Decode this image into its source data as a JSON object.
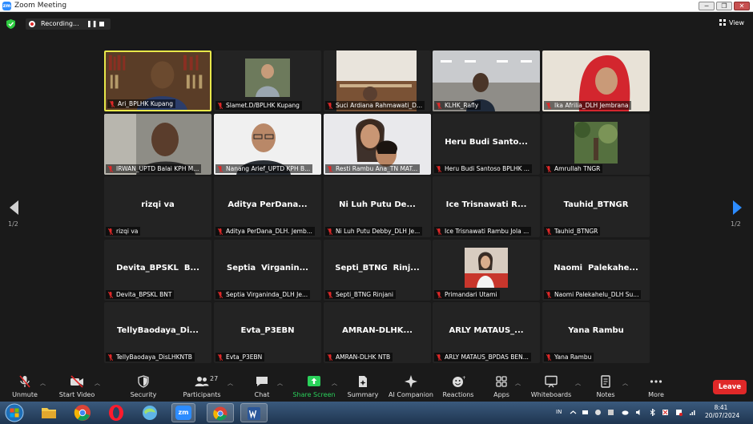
{
  "window": {
    "title": "Zoom Meeting",
    "minimize": "─",
    "maximize": "❐",
    "close": "✕",
    "logo": "zm"
  },
  "meeting_bar": {
    "recording_text": "Recording...",
    "pause": "❚❚",
    "view_label": "View"
  },
  "pager": {
    "prev_page": "1/2",
    "next_page": "1/2"
  },
  "tiles": [
    {
      "label": "Ari_BPLHK Kupang",
      "name": "",
      "active": true,
      "video": "bookshelf"
    },
    {
      "label": "Slamet.D/BPLHK Kupang",
      "name": "",
      "video": "avatar-photo"
    },
    {
      "label": "Suci Ardiana Rahmawati_D...",
      "name": "",
      "video": "room"
    },
    {
      "label": "KLHK_Rafly",
      "name": "",
      "video": "office"
    },
    {
      "label": "Ika Afrilia_DLH Jembrana",
      "name": "",
      "video": "hijab"
    },
    {
      "label": "IRWAN_UPTD Balai KPH M...",
      "name": "",
      "video": "man-dark"
    },
    {
      "label": "Nanang Arief_UPTD KPH B...",
      "name": "",
      "video": "man-glasses"
    },
    {
      "label": "Resti Rambu Ana_TN MAT...",
      "name": "",
      "video": "two-women"
    },
    {
      "label": "Heru Budi Santoso BPLHK ...",
      "name": "Heru Budi Santo..."
    },
    {
      "label": "Amrullah TNGR",
      "name": "",
      "video": "forest-photo"
    },
    {
      "label": "rizqi va",
      "name": "rizqi va"
    },
    {
      "label": "Aditya PerDana_DLH. Jemb...",
      "name": "Aditya PerDana..."
    },
    {
      "label": "Ni Luh Putu Debby_DLH Je...",
      "name": "Ni Luh Putu De..."
    },
    {
      "label": "Ice Trisnawati Rambu Jola ...",
      "name": "Ice Trisnawati R..."
    },
    {
      "label": "Tauhid_BTNGR",
      "name": "Tauhid_BTNGR"
    },
    {
      "label": "Devita_BPSKL BNT",
      "name": "Devita_BPSKL  B..."
    },
    {
      "label": "Septia Virganinda_DLH Je...",
      "name": "Septia  Virganin..."
    },
    {
      "label": "Septi_BTNG Rinjani",
      "name": "Septi_BTNG  Rinj..."
    },
    {
      "label": "Primandari Utami",
      "name": "",
      "video": "woman-photo"
    },
    {
      "label": "Naomi Palekahelu_DLH Su...",
      "name": "Naomi  Palekahe..."
    },
    {
      "label": "TellyBaodaya_DisLHKNTB",
      "name": "TellyBaodaya_Di..."
    },
    {
      "label": "Evta_P3EBN",
      "name": "Evta_P3EBN"
    },
    {
      "label": "AMRAN-DLHK NTB",
      "name": "AMRAN-DLHK..."
    },
    {
      "label": "ARLY MATAUS_BPDAS BEN...",
      "name": "ARLY MATAUS_..."
    },
    {
      "label": "Yana Rambu",
      "name": "Yana Rambu"
    }
  ],
  "toolbar": {
    "unmute": "Unmute",
    "start_video": "Start Video",
    "security": "Security",
    "participants": "Participants",
    "participants_count": "27",
    "chat": "Chat",
    "share_screen": "Share Screen",
    "summary": "Summary",
    "ai_companion": "AI Companion",
    "reactions": "Reactions",
    "apps": "Apps",
    "whiteboards": "Whiteboards",
    "notes": "Notes",
    "more": "More",
    "leave": "Leave",
    "share_color": "#2ad15a",
    "leave_color": "#e02828"
  },
  "taskbar": {
    "apps": [
      "start-orb",
      "file-explorer",
      "chrome",
      "opera",
      "edge-like",
      "zoom",
      "chrome-window",
      "word"
    ],
    "zoom_label": "zm",
    "language": "IN",
    "time": "8:41",
    "date": "20/07/2024"
  }
}
